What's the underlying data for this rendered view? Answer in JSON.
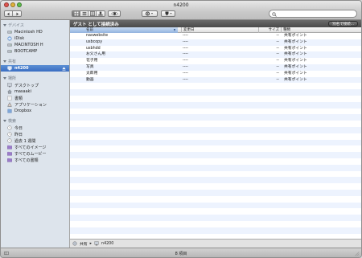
{
  "window": {
    "title": "n4200"
  },
  "toolbar": {
    "back_icon": "back-arrow-icon",
    "forward_icon": "forward-arrow-icon",
    "view_modes": [
      "icon-view",
      "list-view",
      "column-view",
      "coverflow-view"
    ],
    "active_view": "icon-view",
    "quicklook_icon": "eye-icon",
    "action_icon": "gear-icon",
    "share_icon": "shield-icon",
    "search": {
      "placeholder": "",
      "value": ""
    }
  },
  "sidebar": {
    "sections": [
      {
        "title": "デバイス",
        "items": [
          {
            "label": "Macintosh HD",
            "icon": "hard-drive-icon"
          },
          {
            "label": "iDisk",
            "icon": "idisk-icon"
          },
          {
            "label": "MACINTOSH H",
            "icon": "hard-drive-icon"
          },
          {
            "label": "BOOTCAMP",
            "icon": "hard-drive-icon"
          }
        ]
      },
      {
        "title": "共有",
        "items": [
          {
            "label": "n4200",
            "icon": "server-icon",
            "selected": true
          }
        ]
      },
      {
        "title": "場所",
        "items": [
          {
            "label": "デスクトップ",
            "icon": "desktop-icon"
          },
          {
            "label": "masaaki",
            "icon": "home-icon"
          },
          {
            "label": "書類",
            "icon": "documents-icon"
          },
          {
            "label": "アプリケーション",
            "icon": "applications-icon"
          },
          {
            "label": "Dropbox",
            "icon": "dropbox-icon"
          }
        ]
      },
      {
        "title": "検索",
        "items": [
          {
            "label": "今日",
            "icon": "clock-icon"
          },
          {
            "label": "昨日",
            "icon": "clock-icon"
          },
          {
            "label": "過去 1 週間",
            "icon": "clock-icon"
          },
          {
            "label": "すべてのイメージ",
            "icon": "purple-folder-icon"
          },
          {
            "label": "すべてのムービー",
            "icon": "purple-folder-icon"
          },
          {
            "label": "すべての書類",
            "icon": "purple-folder-icon"
          }
        ]
      }
    ]
  },
  "main": {
    "banner": "ゲスト として接続済み",
    "connect_button": "別名で接続...",
    "columns": [
      "名前",
      "変更日",
      "サイズ",
      "種類"
    ],
    "rows": [
      [
        "naswebsite",
        "----",
        "--",
        "共有ポイント"
      ],
      [
        "usbcopy",
        "----",
        "--",
        "共有ポイント"
      ],
      [
        "usbhdd",
        "----",
        "--",
        "共有ポイント"
      ],
      [
        "お父さん用",
        "----",
        "--",
        "共有ポイント"
      ],
      [
        "花子用",
        "----",
        "--",
        "共有ポイント"
      ],
      [
        "写真",
        "----",
        "--",
        "共有ポイント"
      ],
      [
        "太郎用",
        "----",
        "--",
        "共有ポイント"
      ],
      [
        "動画",
        "----",
        "--",
        "共有ポイント"
      ]
    ],
    "path": [
      "共有",
      "n4200"
    ]
  },
  "status": {
    "text": "8 項目"
  },
  "colors": {
    "selection": "#3a6ec2",
    "sidebar_bg": "#dde4ec",
    "alt_row": "#edf3fe",
    "banner": "#4a4a4a"
  }
}
